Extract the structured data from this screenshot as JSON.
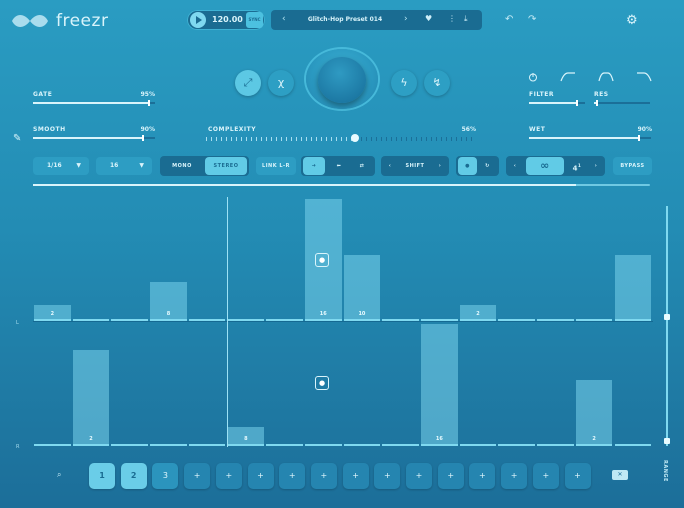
{
  "app": {
    "name": "freezr"
  },
  "transport": {
    "bpm": "120.00",
    "sync_label": "SYNC"
  },
  "preset": {
    "name": "Glitch-Hop Preset 014",
    "prev": "‹",
    "next": "›"
  },
  "icons": {
    "heart": "♥",
    "menu": "⋮",
    "download": "⤓",
    "undo": "↶",
    "redo": "↷",
    "gear": "⚙",
    "feather": "✎",
    "search": "⌕",
    "clear": "✕"
  },
  "modes": [
    "⤢",
    "χ",
    "ϟ",
    "↯"
  ],
  "sliders": {
    "gate": {
      "label": "GATE",
      "value": "95%",
      "level": 0.95
    },
    "smooth": {
      "label": "SMOOTH",
      "value": "90%",
      "level": 0.9
    },
    "complexity": {
      "label": "COMPLEXITY",
      "value": "56%",
      "level": 0.56
    },
    "filter": {
      "label": "FILTER",
      "level": 0.85
    },
    "res": {
      "label": "RES",
      "level": 0.05
    },
    "wet": {
      "label": "WET",
      "value": "90%",
      "level": 0.9
    }
  },
  "toolbar": {
    "rate": "1/16",
    "steps": "16",
    "mono": "MONO",
    "stereo": "STEREO",
    "link": "LINK L-R",
    "shift": "SHIFT",
    "loop_count": "4",
    "loop_sup": "1",
    "bypass": "BYPASS"
  },
  "playback_progress": 0.88,
  "lanes": {
    "left_tag": "L",
    "right_tag": "R",
    "left_bars": [
      {
        "col": 0,
        "value": "2",
        "h": 0.12
      },
      {
        "col": 3,
        "value": "8",
        "h": 0.31
      },
      {
        "col": 7,
        "value": "16",
        "h": 1.0
      },
      {
        "col": 8,
        "value": "10",
        "h": 0.53
      },
      {
        "col": 11,
        "value": "2",
        "h": 0.12
      },
      {
        "col": 15,
        "value": "",
        "h": 0.53
      }
    ],
    "right_bars": [
      {
        "col": 1,
        "value": "2",
        "h": 0.78
      },
      {
        "col": 5,
        "value": "8",
        "h": 0.14
      },
      {
        "col": 10,
        "value": "16",
        "h": 1.0
      },
      {
        "col": 14,
        "value": "2",
        "h": 0.53
      }
    ]
  },
  "range_label": "RANGE",
  "pages": [
    "1",
    "2",
    "3",
    "+",
    "+",
    "+",
    "+",
    "+",
    "+",
    "+",
    "+",
    "+",
    "+",
    "+",
    "+",
    "+"
  ]
}
